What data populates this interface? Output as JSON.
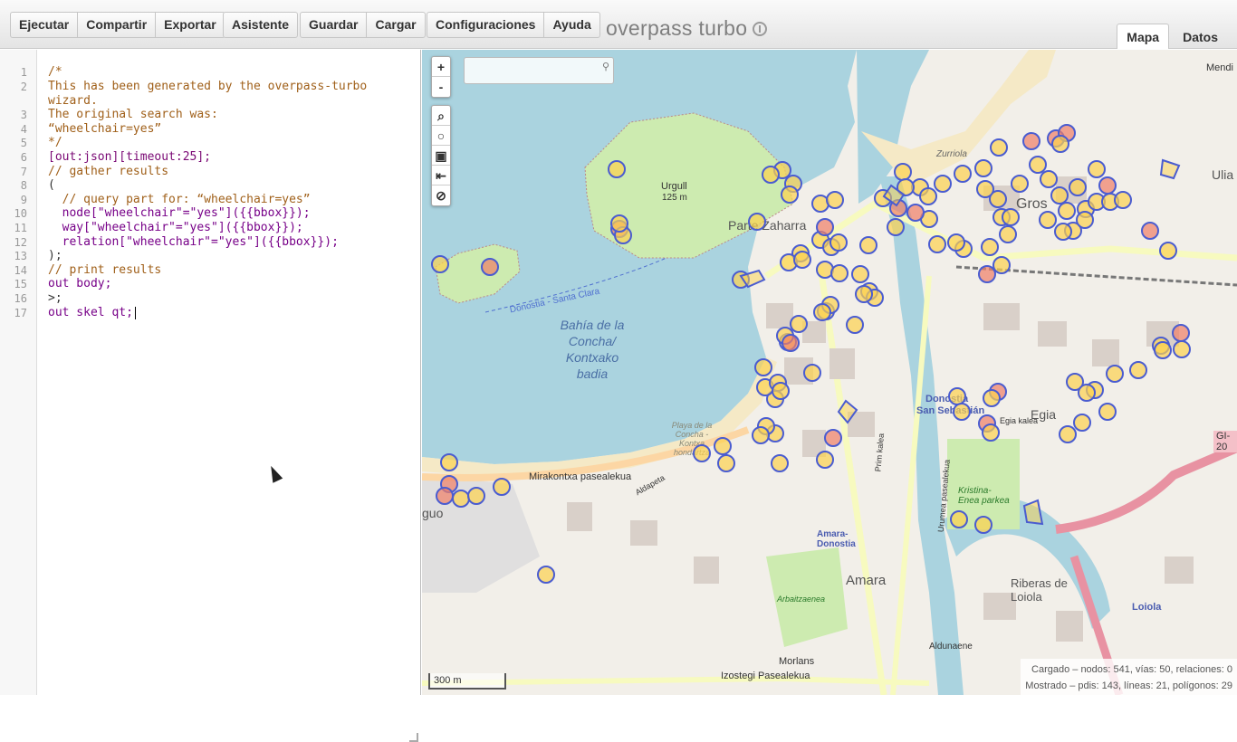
{
  "toolbar": {
    "run": "Ejecutar",
    "share": "Compartir",
    "export": "Exportar",
    "wizard": "Asistente",
    "save": "Guardar",
    "load": "Cargar",
    "settings": "Configuraciones",
    "help": "Ayuda"
  },
  "brand": "overpass turbo",
  "tabs": {
    "map": "Mapa",
    "data": "Datos"
  },
  "editor": {
    "line_numbers": [
      "1",
      "2",
      "",
      "3",
      "4",
      "5",
      "6",
      "7",
      "8",
      "9",
      "10",
      "11",
      "12",
      "13",
      "14",
      "15",
      "16",
      "17"
    ],
    "lines": {
      "l1": "/*",
      "l2a": "This has been generated by the overpass-turbo",
      "l2b": "wizard.",
      "l3": "The original search was:",
      "l4": "“wheelchair=yes”",
      "l5": "*/",
      "l6a": "[out:json][timeout:25];",
      "l7": "// gather results",
      "l8": "(",
      "l9": "  // query part for: “wheelchair=yes”",
      "l10": "  node[\"wheelchair\"=\"yes\"]({{bbox}});",
      "l11": "  way[\"wheelchair\"=\"yes\"]({{bbox}});",
      "l12": "  relation[\"wheelchair\"=\"yes\"]({{bbox}});",
      "l13": ");",
      "l14": "// print results",
      "l15": "out body;",
      "l16": ">;",
      "l17": "out skel qt;"
    }
  },
  "map": {
    "zoom_in": "+",
    "zoom_out": "-",
    "scale": "300 m",
    "labels": {
      "bay": "Bahía de la Concha/ Kontxako badia",
      "ferry": "Donostia - Santa Clara",
      "urgull": "Urgull",
      "urgull_alt": "125 m",
      "zurriola": "Zurriola",
      "gros": "Gros",
      "parte_zaharra": "Parte Zaharra",
      "egia": "Egia",
      "donostia": "Donostia",
      "san_sebastian": "San Sebastián",
      "amara_donostia": "Amara-Donostia",
      "amara": "Amara",
      "riberas": "Riberas de Loiola",
      "loiola": "Loiola",
      "ulia": "Ulia",
      "mendi": "Mendi",
      "mirakontxa": "Mirakontxa pasealekua",
      "playa": "Playa de la Concha - Kontxa hondartza",
      "kristina": "Kristina-Enea parkea",
      "gi20": "GI-20",
      "aldunaene": "Aldunaene",
      "morlans": "Morlans",
      "izostegi": "Izostegi Pasealekua",
      "egia_kalea": "Egia kalea",
      "arbaitzaenea": "Arbaitzaenea",
      "aldapeta": "Aldapeta",
      "prim": "Prim kalea",
      "urumea": "Urumea pasealekua",
      "iguo": "guo"
    },
    "stats": {
      "loaded": "Cargado – nodos: 541, vías: 50, relaciones: 0",
      "shown": "Mostrado – pdis: 143, líneas: 21, polígonos: 29"
    },
    "colors": {
      "sea": "#aad3df",
      "land": "#f2efe9",
      "poi_fill": "#fcd24e",
      "poi_stroke": "#4a5cd0",
      "poi_red": "#ef7f66"
    }
  }
}
